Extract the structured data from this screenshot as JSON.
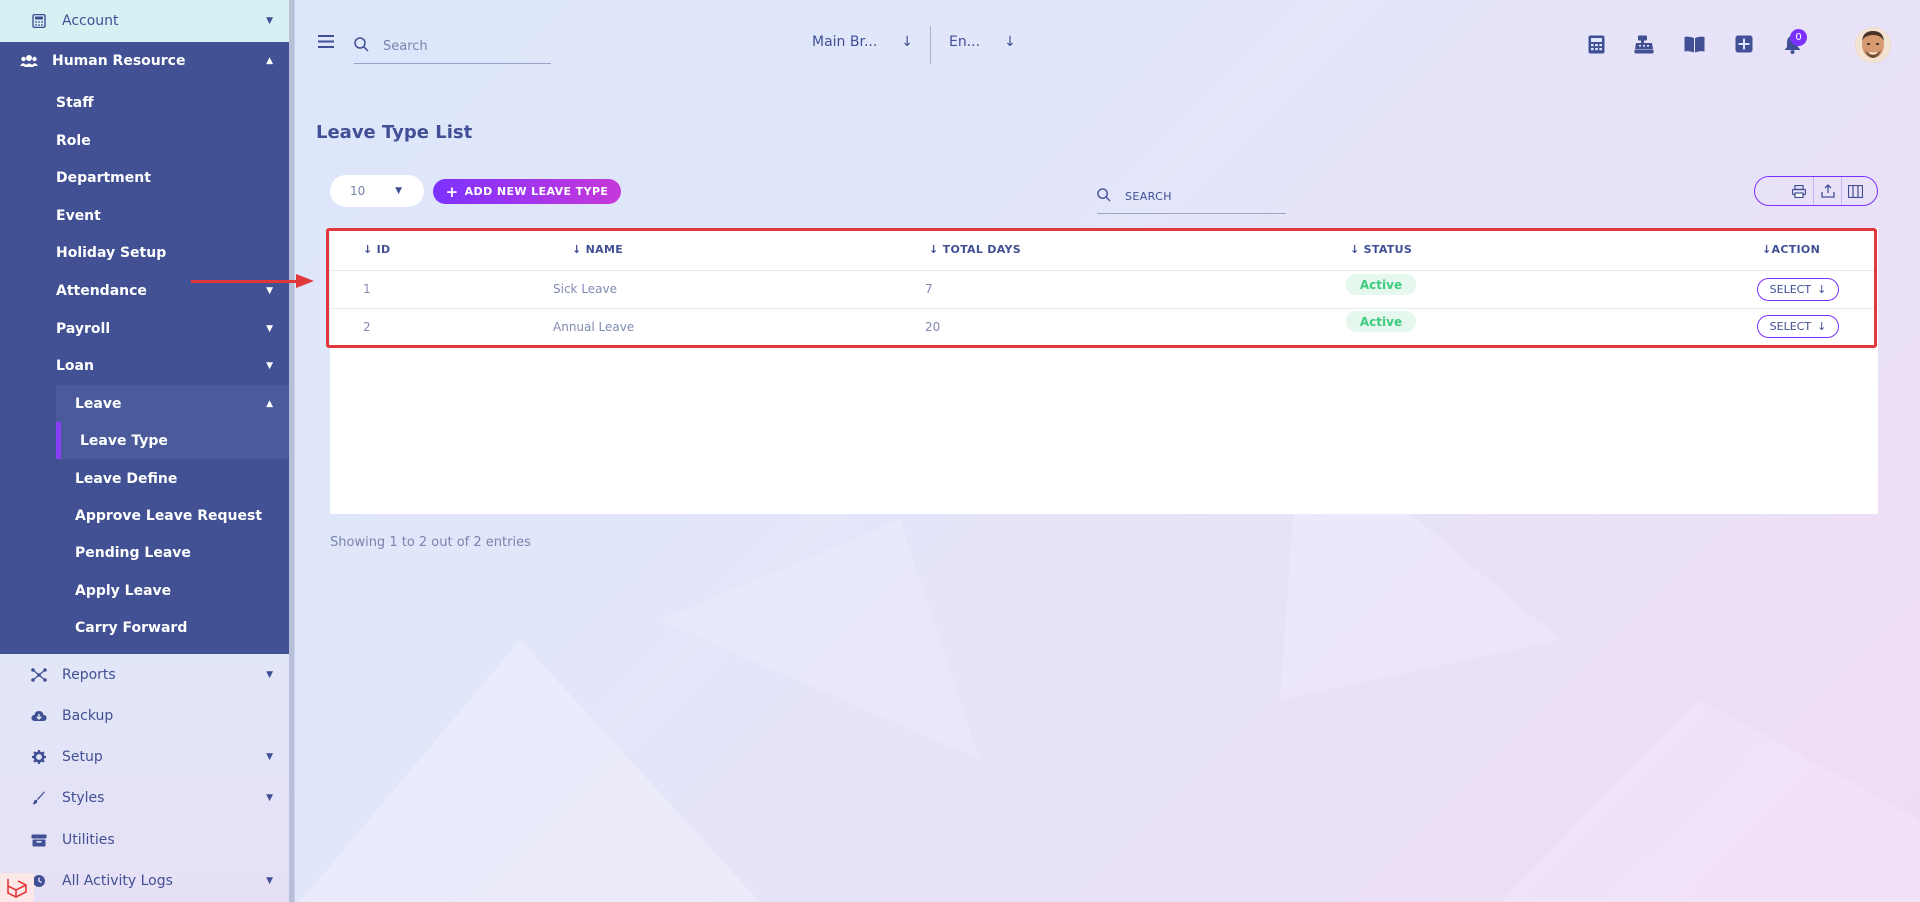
{
  "sidebar": {
    "account": {
      "label": "Account"
    },
    "human_resource": {
      "label": "Human Resource"
    },
    "hr_items": [
      {
        "label": "Staff"
      },
      {
        "label": "Role"
      },
      {
        "label": "Department"
      },
      {
        "label": "Event"
      },
      {
        "label": "Holiday Setup"
      },
      {
        "label": "Attendance"
      },
      {
        "label": "Payroll"
      },
      {
        "label": "Loan"
      }
    ],
    "leave": {
      "label": "Leave",
      "items": [
        {
          "label": "Leave Type",
          "active": true
        },
        {
          "label": "Leave Define"
        },
        {
          "label": "Approve Leave Request"
        },
        {
          "label": "Pending Leave"
        },
        {
          "label": "Apply Leave"
        },
        {
          "label": "Carry Forward"
        }
      ]
    },
    "bottom_items": [
      {
        "label": "Reports",
        "icon": "reports-icon"
      },
      {
        "label": "Backup",
        "icon": "cloud-icon"
      },
      {
        "label": "Setup",
        "icon": "gear-icon"
      },
      {
        "label": "Styles",
        "icon": "brush-icon"
      },
      {
        "label": "Utilities",
        "icon": "box-icon"
      },
      {
        "label": "All Activity Logs",
        "icon": "history-icon"
      }
    ]
  },
  "header": {
    "search_placeholder": "Search",
    "branch": "Main Br...",
    "language": "En...",
    "notification_count": "0"
  },
  "main": {
    "title": "Leave Type List",
    "per_page": "10",
    "add_button": "ADD NEW LEAVE TYPE",
    "search_placeholder": "SEARCH",
    "columns": {
      "id": "ID",
      "name": "NAME",
      "total_days": "TOTAL DAYS",
      "status": "STATUS",
      "action": "ACTION"
    },
    "rows": [
      {
        "id": "1",
        "name": "Sick Leave",
        "total_days": "7",
        "status": "Active",
        "action": "SELECT"
      },
      {
        "id": "2",
        "name": "Annual Leave",
        "total_days": "20",
        "status": "Active",
        "action": "SELECT"
      }
    ],
    "entries_text": "Showing 1 to 2 out of 2 entries"
  },
  "colors": {
    "sidebar_active": "#425193",
    "accent": "#7c32ff",
    "annotation_red": "#e0383b",
    "status_green": "#3ccb7f"
  }
}
